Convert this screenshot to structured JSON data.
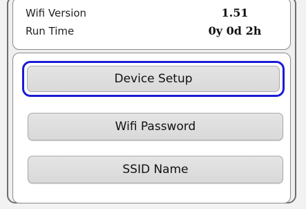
{
  "info": {
    "rows": [
      {
        "label": "Wifi Version",
        "value": "1.51"
      },
      {
        "label": "Run Time",
        "value": "0y 0d 2h"
      }
    ]
  },
  "buttons": {
    "device_setup": "Device Setup",
    "wifi_password": "Wifi Password",
    "ssid_name": "SSID Name"
  },
  "colors": {
    "focus_ring": "#1a1ad6",
    "button_fill": "#dddddd"
  }
}
